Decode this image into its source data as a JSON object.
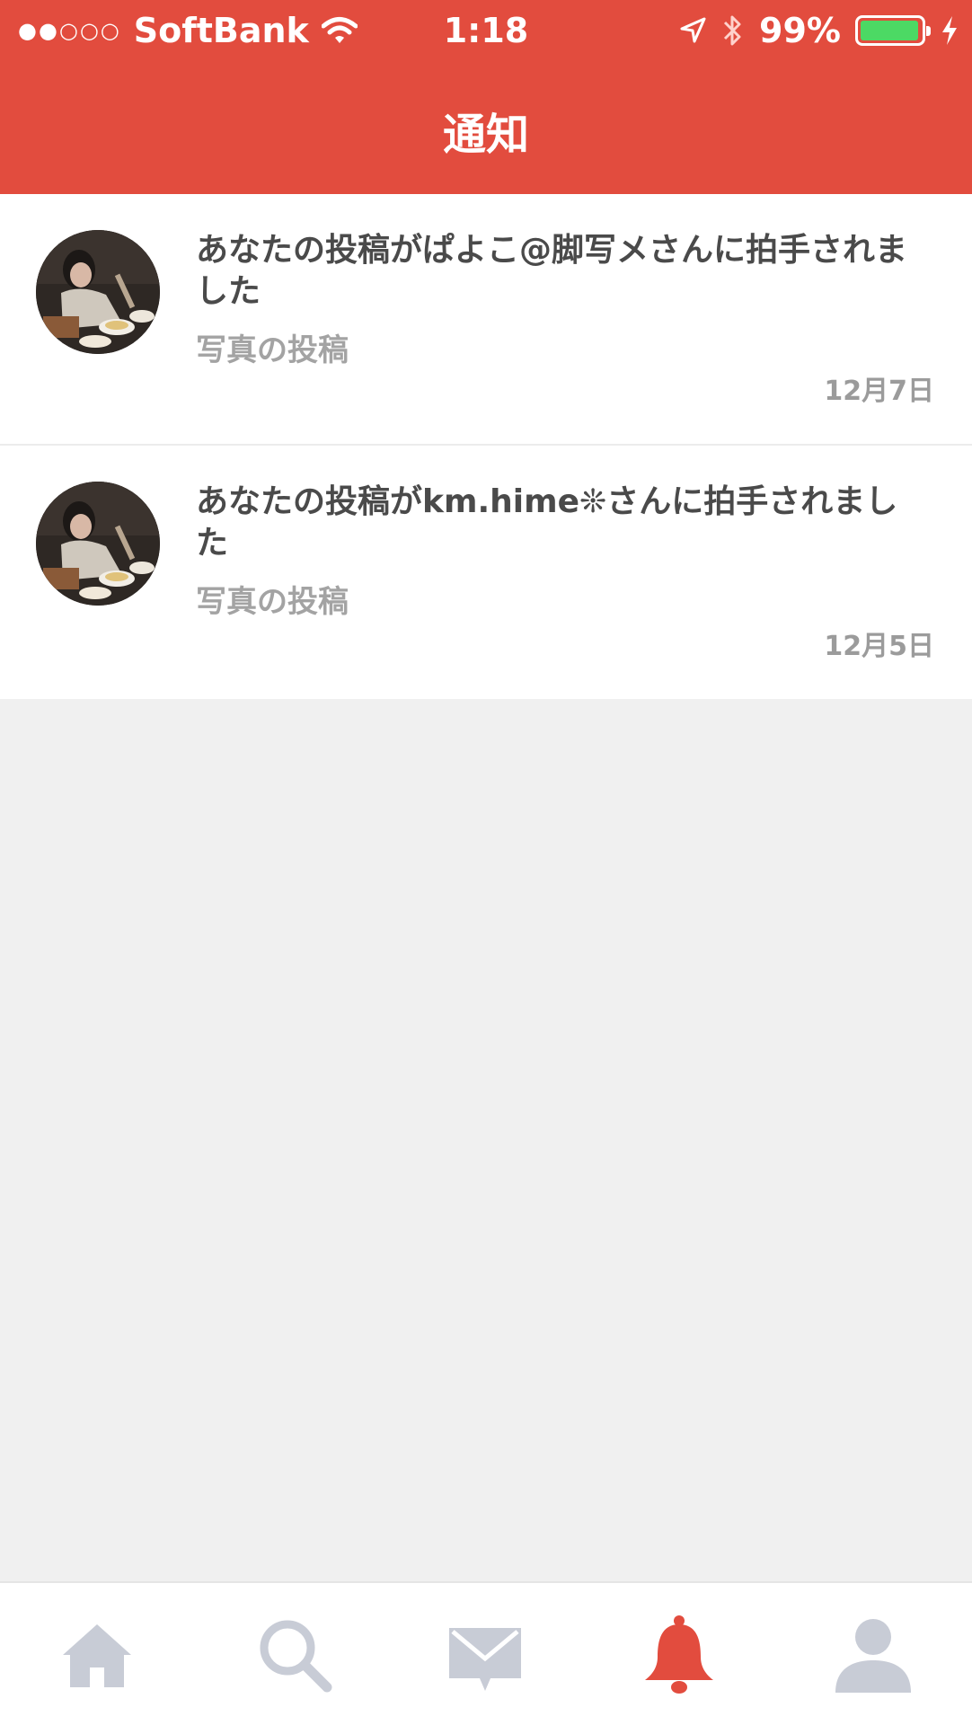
{
  "status_bar": {
    "signal_dots": "●●○○○",
    "carrier": "SoftBank",
    "time": "1:18",
    "battery_percent": "99%",
    "battery_level": 0.99
  },
  "header": {
    "title": "通知"
  },
  "notifications": [
    {
      "message": "あなたの投稿がぱよこ@脚写メさんに拍手されました",
      "subtitle": "写真の投稿",
      "date": "12月7日"
    },
    {
      "message": "あなたの投稿がkm.hime❊さんに拍手されました",
      "subtitle": "写真の投稿",
      "date": "12月5日"
    }
  ],
  "tabbar": {
    "items": [
      {
        "icon": "home-icon",
        "active": false
      },
      {
        "icon": "search-icon",
        "active": false
      },
      {
        "icon": "mail-icon",
        "active": false
      },
      {
        "icon": "bell-icon",
        "active": true
      },
      {
        "icon": "profile-icon",
        "active": false
      }
    ]
  },
  "colors": {
    "brand": "#e24c3e",
    "tab_inactive": "#c8ccd6",
    "tab_active": "#e24c3e",
    "battery": "#4cd964"
  }
}
